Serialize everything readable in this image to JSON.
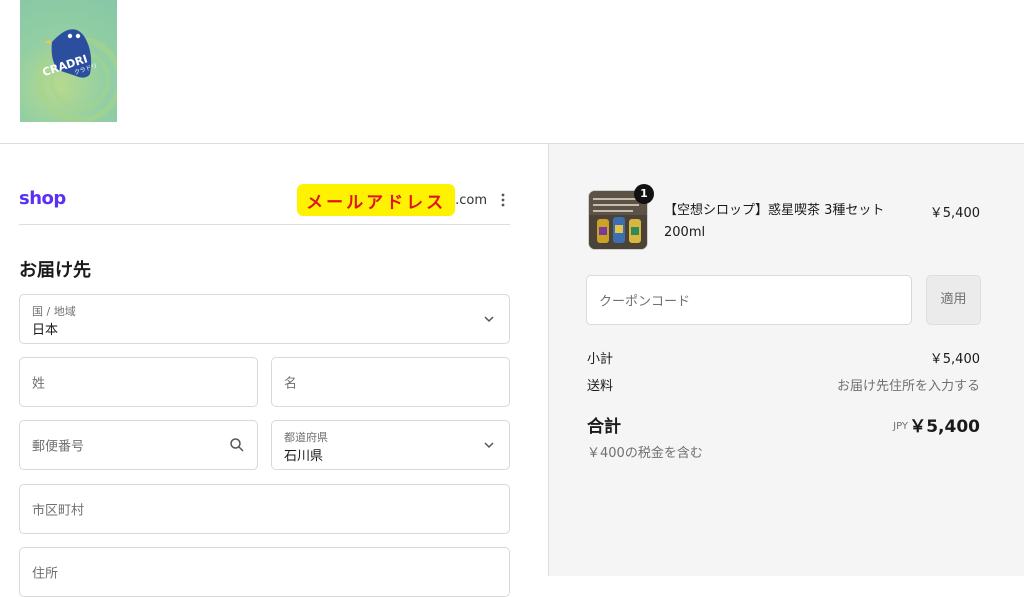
{
  "header": {
    "logo_text": "CRADRI",
    "logo_subtext": "クラドリ"
  },
  "account": {
    "brand": "shop",
    "email_masked": "メールアドレス",
    "email_suffix": ".com",
    "menu_icon": "kebab-menu-icon"
  },
  "delivery": {
    "title": "お届け先",
    "country": {
      "label": "国 / 地域",
      "value": "日本"
    },
    "last_name": {
      "placeholder": "姓"
    },
    "first_name": {
      "placeholder": "名"
    },
    "postal_code": {
      "placeholder": "郵便番号"
    },
    "prefecture": {
      "label": "都道府県",
      "value": "石川県"
    },
    "city": {
      "placeholder": "市区町村"
    },
    "address": {
      "placeholder": "住所"
    }
  },
  "order": {
    "item": {
      "quantity": "1",
      "name": "【空想シロップ】惑星喫茶 3種セット 200ml",
      "price": "￥5,400"
    },
    "coupon": {
      "placeholder": "クーポンコード",
      "apply_label": "適用"
    },
    "subtotal": {
      "label": "小計",
      "value": "￥5,400"
    },
    "shipping": {
      "label": "送料",
      "value": "お届け先住所を入力する"
    },
    "total": {
      "label": "合計",
      "currency": "JPY",
      "value": "￥5,400"
    },
    "tax_note": "￥400の税金を含む"
  },
  "colors": {
    "shop_brand": "#5a31f4",
    "email_highlight_bg": "#fff200",
    "email_highlight_text": "#e0141e",
    "summary_bg": "#f5f5f5"
  }
}
